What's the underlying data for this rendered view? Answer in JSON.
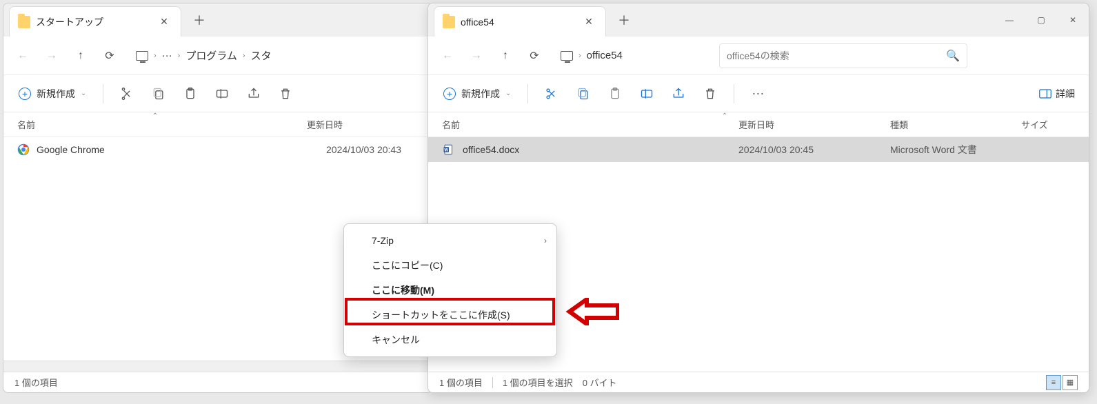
{
  "w1": {
    "tab_title": "スタートアップ",
    "breadcrumb": {
      "ellipsis": "···",
      "seg1": "プログラム",
      "seg2": "スタ"
    },
    "new_label": "新規作成",
    "col_name": "名前",
    "col_date": "更新日時",
    "files": [
      {
        "name": "Google Chrome",
        "date": "2024/10/03 20:43"
      }
    ],
    "status": "1 個の項目"
  },
  "w2": {
    "tab_title": "office54",
    "breadcrumb": {
      "seg1": "office54"
    },
    "search_placeholder": "office54の検索",
    "new_label": "新規作成",
    "details_label": "詳細",
    "col_name": "名前",
    "col_date": "更新日時",
    "col_type": "種類",
    "col_size": "サイズ",
    "files": [
      {
        "name": "office54.docx",
        "date": "2024/10/03 20:45",
        "type": "Microsoft Word 文書"
      }
    ],
    "status1": "1 個の項目",
    "status2": "1 個の項目を選択",
    "status3": "0 バイト"
  },
  "menu": {
    "i1": "7-Zip",
    "i2": "ここにコピー(C)",
    "i3": "ここに移動(M)",
    "i4": "ショートカットをここに作成(S)",
    "i5": "キャンセル"
  }
}
